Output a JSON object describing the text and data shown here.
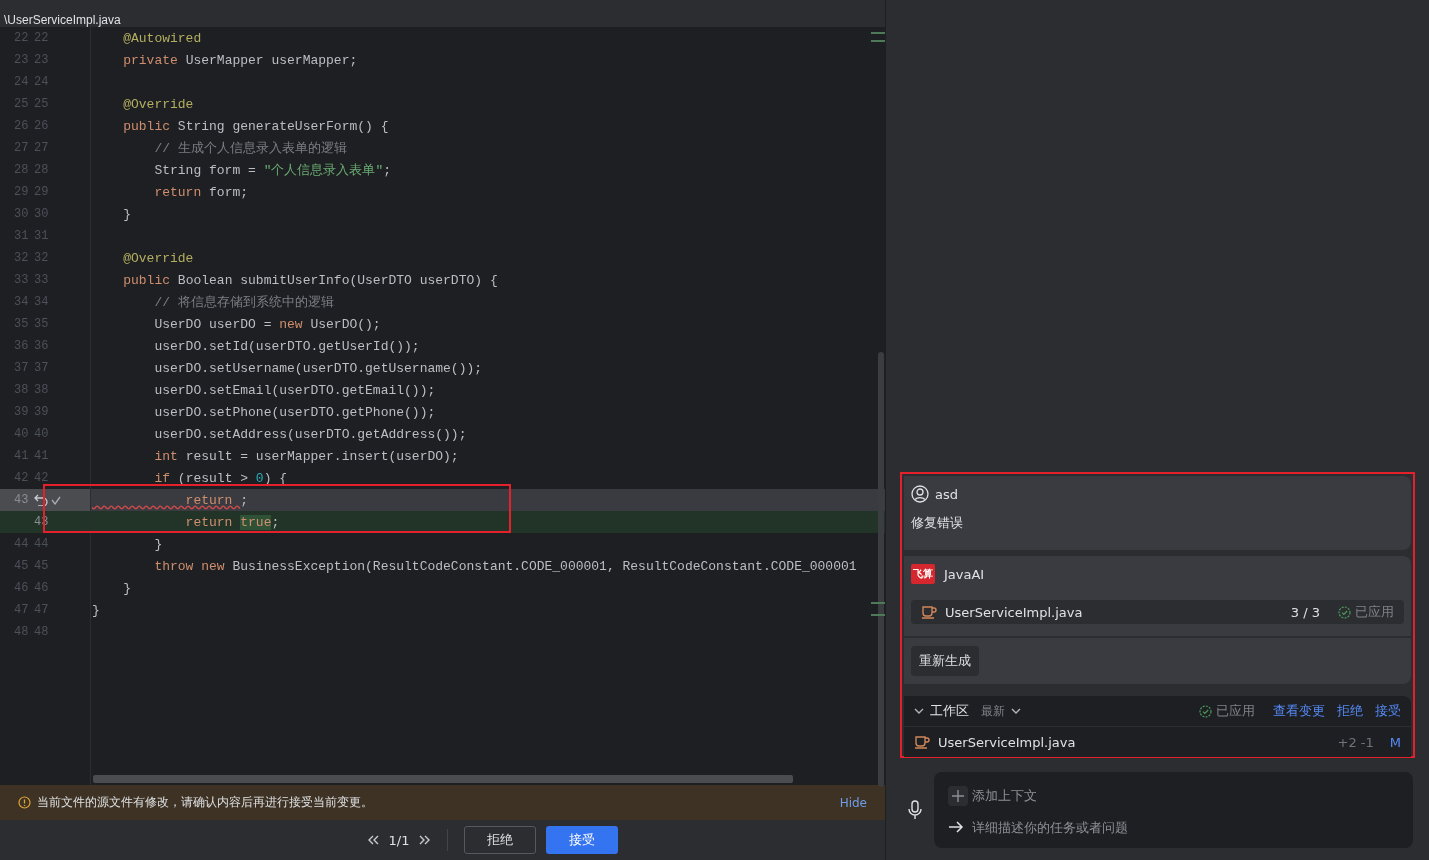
{
  "editor": {
    "path_lines": [
      "\\UserServiceImpl.java"
    ],
    "lines": [
      {
        "old": "22",
        "new": "22",
        "kind": "normal",
        "tokens": [
          {
            "kind": "ann",
            "text": "    @Autowired"
          }
        ]
      },
      {
        "old": "23",
        "new": "23",
        "kind": "normal",
        "tokens": [
          {
            "kind": "kw",
            "text": "    private "
          },
          {
            "kind": "id",
            "text": "UserMapper userMapper;"
          }
        ]
      },
      {
        "old": "24",
        "new": "24",
        "kind": "normal"
      },
      {
        "old": "25",
        "new": "25",
        "kind": "normal",
        "tokens": [
          {
            "kind": "ann",
            "text": "    @Override"
          }
        ]
      },
      {
        "old": "26",
        "new": "26",
        "kind": "normal",
        "tokens": [
          {
            "kind": "kw",
            "text": "    public "
          },
          {
            "kind": "id",
            "text": "String generateUserForm() {"
          }
        ]
      },
      {
        "old": "27",
        "new": "27",
        "kind": "normal",
        "tokens": [
          {
            "kind": "cm",
            "text": "        // 生成个人信息录入表单的逻辑"
          }
        ]
      },
      {
        "old": "28",
        "new": "28",
        "kind": "normal",
        "tokens": [
          {
            "kind": "id",
            "text": "        String form = "
          },
          {
            "kind": "str",
            "text": "\"个人信息录入表单\""
          },
          {
            "kind": "id",
            "text": ";"
          }
        ]
      },
      {
        "old": "29",
        "new": "29",
        "kind": "normal",
        "tokens": [
          {
            "kind": "kw",
            "text": "        return "
          },
          {
            "kind": "id",
            "text": "form;"
          }
        ]
      },
      {
        "old": "30",
        "new": "30",
        "kind": "normal",
        "tokens": [
          {
            "kind": "id",
            "text": "    }"
          }
        ]
      },
      {
        "old": "31",
        "new": "31",
        "kind": "normal"
      },
      {
        "old": "32",
        "new": "32",
        "kind": "normal",
        "tokens": [
          {
            "kind": "ann",
            "text": "    @Override"
          }
        ]
      },
      {
        "old": "33",
        "new": "33",
        "kind": "normal",
        "tokens": [
          {
            "kind": "kw",
            "text": "    public "
          },
          {
            "kind": "id",
            "text": "Boolean submitUserInfo(UserDTO userDTO) {"
          }
        ]
      },
      {
        "old": "34",
        "new": "34",
        "kind": "normal",
        "tokens": [
          {
            "kind": "cm",
            "text": "        // 将信息存储到系统中的逻辑"
          }
        ]
      },
      {
        "old": "35",
        "new": "35",
        "kind": "normal",
        "tokens": [
          {
            "kind": "id",
            "text": "        UserDO userDO = "
          },
          {
            "kind": "kw",
            "text": "new "
          },
          {
            "kind": "id",
            "text": "UserDO();"
          }
        ]
      },
      {
        "old": "36",
        "new": "36",
        "kind": "normal",
        "tokens": [
          {
            "kind": "id",
            "text": "        userDO.setId(userDTO.getUserId());"
          }
        ]
      },
      {
        "old": "37",
        "new": "37",
        "kind": "normal",
        "tokens": [
          {
            "kind": "id",
            "text": "        userDO.setUsername(userDTO.getUsername());"
          }
        ]
      },
      {
        "old": "38",
        "new": "38",
        "kind": "normal",
        "tokens": [
          {
            "kind": "id",
            "text": "        userDO.setEmail(userDTO.getEmail());"
          }
        ]
      },
      {
        "old": "39",
        "new": "39",
        "kind": "normal",
        "tokens": [
          {
            "kind": "id",
            "text": "        userDO.setPhone(userDTO.getPhone());"
          }
        ]
      },
      {
        "old": "40",
        "new": "40",
        "kind": "normal",
        "tokens": [
          {
            "kind": "id",
            "text": "        userDO.setAddress(userDTO.getAddress());"
          }
        ]
      },
      {
        "old": "41",
        "new": "41",
        "kind": "normal",
        "tokens": [
          {
            "kind": "kw",
            "text": "        int "
          },
          {
            "kind": "id",
            "text": "result = userMapper.insert(userDO);"
          }
        ]
      },
      {
        "old": "42",
        "new": "42",
        "kind": "normal",
        "tokens": [
          {
            "kind": "kw",
            "text": "        if "
          },
          {
            "kind": "id",
            "text": "(result > "
          },
          {
            "kind": "num",
            "text": "0"
          },
          {
            "kind": "id",
            "text": ") {"
          }
        ]
      },
      {
        "old": "43",
        "kind": "deleted",
        "tokens": [
          {
            "kind": "err",
            "text": "            return "
          },
          {
            "kind": "id",
            "text": ";"
          }
        ]
      },
      {
        "new": "43",
        "kind": "added",
        "tokens": [
          {
            "kind": "kw",
            "text": "            return "
          },
          {
            "kind": "hl",
            "text": "true"
          },
          {
            "kind": "id",
            "text": ";"
          }
        ]
      },
      {
        "old": "44",
        "new": "44",
        "kind": "normal",
        "tokens": [
          {
            "kind": "id",
            "text": "        }"
          }
        ]
      },
      {
        "old": "45",
        "new": "45",
        "kind": "normal",
        "tokens": [
          {
            "kind": "kw",
            "text": "        throw new "
          },
          {
            "kind": "id",
            "text": "BusinessException(ResultCodeConstant.CODE_000001, ResultCodeConstant.CODE_000001"
          }
        ]
      },
      {
        "old": "46",
        "new": "46",
        "kind": "normal",
        "tokens": [
          {
            "kind": "id",
            "text": "    }"
          }
        ]
      },
      {
        "old": "47",
        "new": "47",
        "kind": "normal",
        "tokens": [
          {
            "kind": "id",
            "text": "}"
          }
        ]
      },
      {
        "old": "48",
        "new": "48",
        "kind": "normal"
      }
    ]
  },
  "warning": {
    "text": "当前文件的源文件有修改，请确认内容后再进行接受当前变更。",
    "hide": "Hide"
  },
  "diff_nav": {
    "counter": "1/1",
    "reject": "拒绝",
    "accept": "接受"
  },
  "chat": {
    "messages": [
      {
        "kind": "user",
        "author": "asd",
        "text": "修复错误"
      },
      {
        "kind": "ai",
        "author": "JavaAI",
        "logo_text": "飞算",
        "file": {
          "name": "UserServiceImpl.java",
          "count": "3 / 3",
          "status": "已应用"
        },
        "action": "重新生成"
      }
    ],
    "workspace": {
      "title": "工作区",
      "expanded": true,
      "filter": "最新",
      "status": "已应用",
      "links": [
        "查看变更",
        "拒绝",
        "接受"
      ],
      "files": [
        {
          "name": "UserServiceImpl.java",
          "added": "+2",
          "removed": "-1",
          "status": "M"
        }
      ]
    },
    "input": {
      "context": "添加上下文",
      "placeholder": "详细描述你的任务或者问题"
    }
  }
}
